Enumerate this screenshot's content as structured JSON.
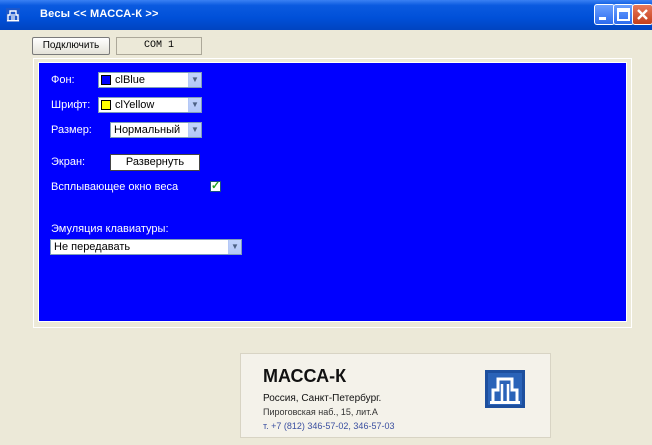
{
  "window": {
    "title": "Весы   << МАССА-К >>"
  },
  "toolbar": {
    "connect_label": "Подключить",
    "port_value": "COM 1"
  },
  "settings": {
    "background": {
      "label": "Фон:",
      "value": "clBlue",
      "swatch_color": "#0000ff"
    },
    "font": {
      "label": "Шрифт:",
      "value": "clYellow",
      "swatch_color": "#ffff00"
    },
    "size": {
      "label": "Размер:",
      "value": "Нормальный"
    },
    "screen": {
      "label": "Экран:",
      "button_label": "Развернуть"
    },
    "popup": {
      "label": "Всплывающее окно веса",
      "checked": true
    },
    "keyboard": {
      "label": "Эмуляция клавиатуры:",
      "value": "Не передавать"
    }
  },
  "company": {
    "name": "МАССА-К",
    "city": "Россия, Санкт-Петербург.",
    "address": "Пироговская наб., 15, лит.А",
    "phone": "т. +7 (812) 346-57-02,  346-57-03"
  },
  "colors": {
    "panel_background": "#0000ff",
    "title_bar": "#0050d8",
    "window_background": "#ece9d8"
  }
}
